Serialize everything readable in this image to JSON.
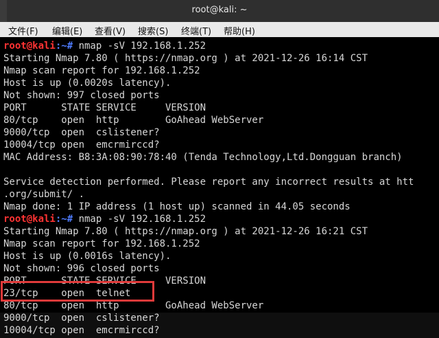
{
  "window": {
    "title": "root@kali: ~"
  },
  "menu": [
    {
      "label": "文件(F)"
    },
    {
      "label": "编辑(E)"
    },
    {
      "label": "查看(V)"
    },
    {
      "label": "搜索(S)"
    },
    {
      "label": "终端(T)"
    },
    {
      "label": "帮助(H)"
    }
  ],
  "terminal": {
    "prompt_user": "root@kali",
    "prompt_path": ":~# ",
    "lines": [
      {
        "cmd": "nmap -sV 192.168.1.252"
      },
      {
        "text": "Starting Nmap 7.80 ( https://nmap.org ) at 2021-12-26 16:14 CST"
      },
      {
        "text": "Nmap scan report for 192.168.1.252"
      },
      {
        "text": "Host is up (0.0020s latency)."
      },
      {
        "text": "Not shown: 997 closed ports"
      },
      {
        "text": "PORT      STATE SERVICE     VERSION"
      },
      {
        "text": "80/tcp    open  http        GoAhead WebServer"
      },
      {
        "text": "9000/tcp  open  cslistener?"
      },
      {
        "text": "10004/tcp open  emcrmirccd?"
      },
      {
        "text": "MAC Address: B8:3A:08:90:78:40 (Tenda Technology,Ltd.Dongguan branch)"
      },
      {
        "text": ""
      },
      {
        "text": "Service detection performed. Please report any incorrect results at htt"
      },
      {
        "text": ".org/submit/ ."
      },
      {
        "text": "Nmap done: 1 IP address (1 host up) scanned in 44.05 seconds"
      },
      {
        "cmd": "nmap -sV 192.168.1.252"
      },
      {
        "text": "Starting Nmap 7.80 ( https://nmap.org ) at 2021-12-26 16:21 CST"
      },
      {
        "text": "Nmap scan report for 192.168.1.252"
      },
      {
        "text": "Host is up (0.0016s latency)."
      },
      {
        "text": "Not shown: 996 closed ports"
      },
      {
        "text": "PORT      STATE SERVICE     VERSION"
      },
      {
        "text": "23/tcp    open  telnet"
      },
      {
        "text": "80/tcp    open  http        GoAhead WebServer"
      },
      {
        "text": "9000/tcp  open  cslistener?"
      },
      {
        "text": "10004/tcp open  emcrmirccd?"
      }
    ]
  },
  "colors": {
    "highlight_box": "#e03a3a",
    "prompt_user": "#ff3333",
    "prompt_path": "#4f7cff"
  }
}
